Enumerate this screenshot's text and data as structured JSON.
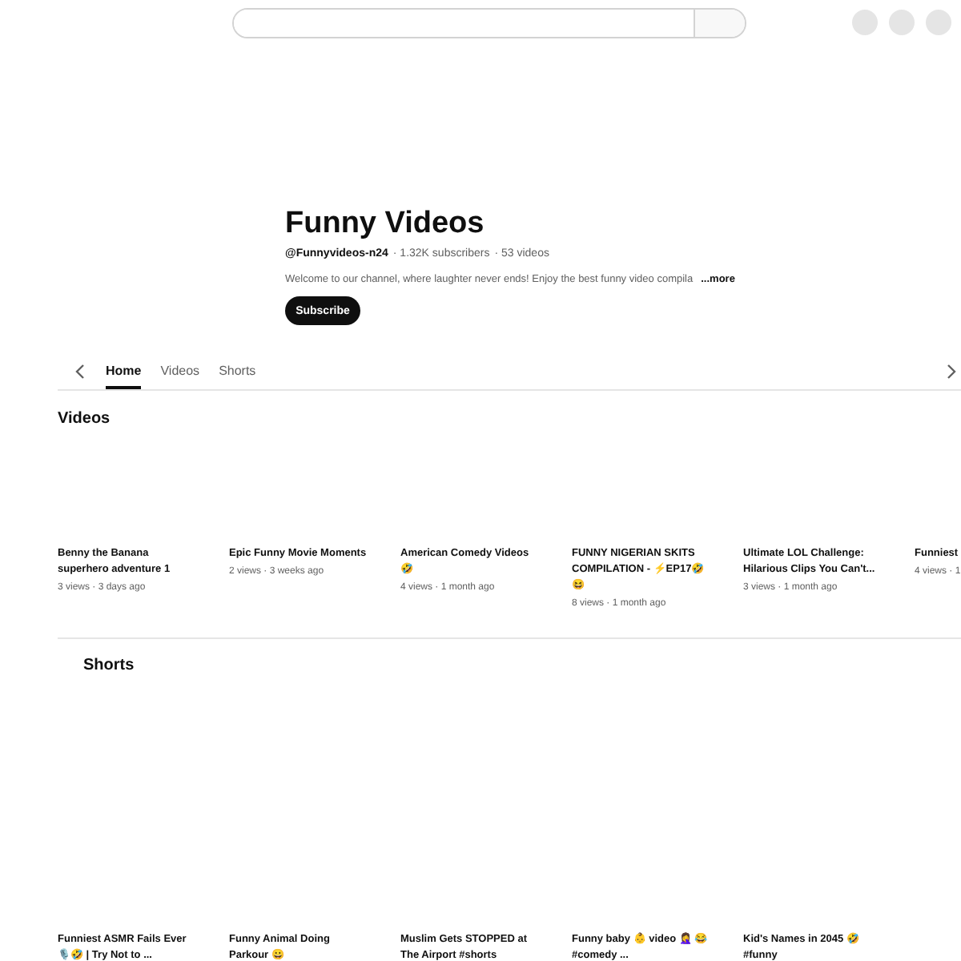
{
  "channel": {
    "name": "Funny Videos",
    "handle": "@Funnyvideos-n24",
    "subscribers": "· 1.32K subscribers",
    "videos_count": "· 53 videos",
    "description": "Welcome to our channel, where laughter never ends! Enjoy the best funny video compila",
    "more": "...more",
    "subscribe": "Subscribe"
  },
  "tabs": [
    {
      "label": "Home",
      "selected": true
    },
    {
      "label": "Videos",
      "selected": false
    },
    {
      "label": "Shorts",
      "selected": false
    }
  ],
  "videos": {
    "heading": "Videos",
    "items": [
      {
        "title": "Benny the Banana superhero adventure 1",
        "meta": "3 views · 3 days ago"
      },
      {
        "title": "Epic Funny Movie Moments",
        "meta": "2 views · 3 weeks ago"
      },
      {
        "title": "American Comedy Videos🤣",
        "meta": "4 views · 1 month ago"
      },
      {
        "title": "FUNNY NIGERIAN SKITS COMPILATION - ⚡EP17🤣😆",
        "meta": "8 views · 1 month ago"
      },
      {
        "title": "Ultimate LOL Challenge: Hilarious Clips You Can't...",
        "meta": "3 views · 1 month ago"
      },
      {
        "title": "Funniest",
        "meta": "4 views · 1"
      }
    ]
  },
  "shorts": {
    "heading": "Shorts",
    "items": [
      {
        "title": "Funniest ASMR Fails Ever 🎙️🤣 | Try Not to ..."
      },
      {
        "title": "Funny Animal Doing Parkour 😀"
      },
      {
        "title": "Muslim Gets STOPPED at The Airport #shorts"
      },
      {
        "title": "Funny baby 👶 video 🤦‍♀️ 😂 #comedy ..."
      },
      {
        "title": "Kid's Names in 2045 🤣 #funny"
      }
    ]
  }
}
